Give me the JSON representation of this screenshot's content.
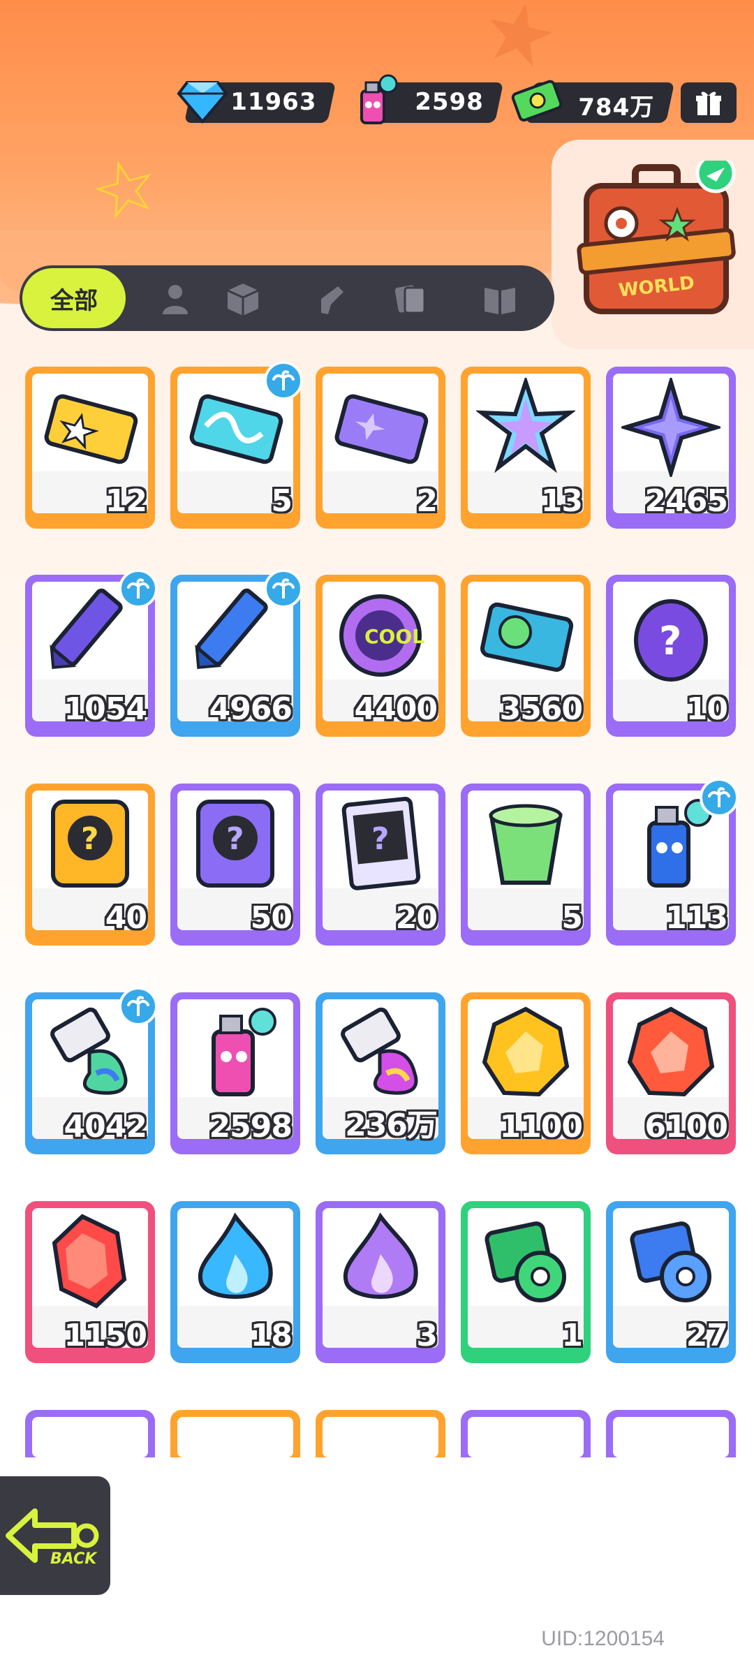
{
  "currencies": [
    {
      "name": "diamond",
      "value": "11963",
      "icon": "diamond-icon"
    },
    {
      "name": "spray",
      "value": "2598",
      "icon": "spray-can-icon"
    },
    {
      "name": "cash",
      "value": "784万",
      "icon": "cash-icon"
    }
  ],
  "world_card": {
    "label": "WORLD"
  },
  "tabs": {
    "all_label": "全部",
    "icons": [
      "person-icon",
      "box-icon",
      "spray-gun-icon",
      "cards-icon",
      "book-icon"
    ]
  },
  "items": [
    {
      "count": "12",
      "color": "#ffa32e",
      "icon": "gold-ticket-icon",
      "badge": false
    },
    {
      "count": "5",
      "color": "#ffa32e",
      "icon": "wave-ticket-icon",
      "badge": true
    },
    {
      "count": "2",
      "color": "#ffa32e",
      "icon": "purple-ticket-icon",
      "badge": false
    },
    {
      "count": "13",
      "color": "#ffa32e",
      "icon": "rainbow-star-icon",
      "badge": false
    },
    {
      "count": "2465",
      "color": "#9b6cf5",
      "icon": "purple-star-icon",
      "badge": false
    },
    {
      "count": "1054",
      "color": "#9b6cf5",
      "icon": "purple-crayon-icon",
      "badge": true
    },
    {
      "count": "4966",
      "color": "#3fa5ee",
      "icon": "blue-crayon-icon",
      "badge": true
    },
    {
      "count": "4400",
      "color": "#ffa32e",
      "icon": "cool-badge-icon",
      "badge": false
    },
    {
      "count": "3560",
      "color": "#ffa32e",
      "icon": "season-ticket-icon",
      "badge": false
    },
    {
      "count": "10",
      "color": "#9b6cf5",
      "icon": "mystery-egg-icon",
      "badge": false
    },
    {
      "count": "40",
      "color": "#ffa32e",
      "icon": "gold-mystery-card-icon",
      "badge": false
    },
    {
      "count": "50",
      "color": "#9b6cf5",
      "icon": "purple-mystery-card-icon",
      "badge": false
    },
    {
      "count": "20",
      "color": "#9b6cf5",
      "icon": "travel-card-icon",
      "badge": false
    },
    {
      "count": "5",
      "color": "#9b6cf5",
      "icon": "open-cup-icon",
      "badge": false
    },
    {
      "count": "113",
      "color": "#9b6cf5",
      "icon": "blue-spray-icon",
      "badge": true
    },
    {
      "count": "4042",
      "color": "#3fa5ee",
      "icon": "paint-tube-icon",
      "badge": true
    },
    {
      "count": "2598",
      "color": "#9b6cf5",
      "icon": "pink-spray-icon",
      "badge": false
    },
    {
      "count": "236万",
      "color": "#3fa5ee",
      "icon": "paint-tube-pink-icon",
      "badge": false
    },
    {
      "count": "1100",
      "color": "#ffa32e",
      "icon": "gold-crystal-icon",
      "badge": false
    },
    {
      "count": "6100",
      "color": "#f0507e",
      "icon": "red-crystal-icon",
      "badge": false
    },
    {
      "count": "1150",
      "color": "#f0507e",
      "icon": "red-gem-icon",
      "badge": false
    },
    {
      "count": "18",
      "color": "#3fa5ee",
      "icon": "blue-flame-icon",
      "badge": false
    },
    {
      "count": "3",
      "color": "#9b6cf5",
      "icon": "purple-flame-icon",
      "badge": false
    },
    {
      "count": "1",
      "color": "#2fd17d",
      "icon": "green-tape-icon",
      "badge": false
    },
    {
      "count": "27",
      "color": "#3fa5ee",
      "icon": "blue-tape-icon",
      "badge": false
    }
  ],
  "partial_row_colors": [
    "#9b6cf5",
    "#ffa32e",
    "#ffa32e",
    "#9b6cf5",
    "#9b6cf5"
  ],
  "back_button": {
    "label": "BACK"
  },
  "uid": "UID:1200154"
}
